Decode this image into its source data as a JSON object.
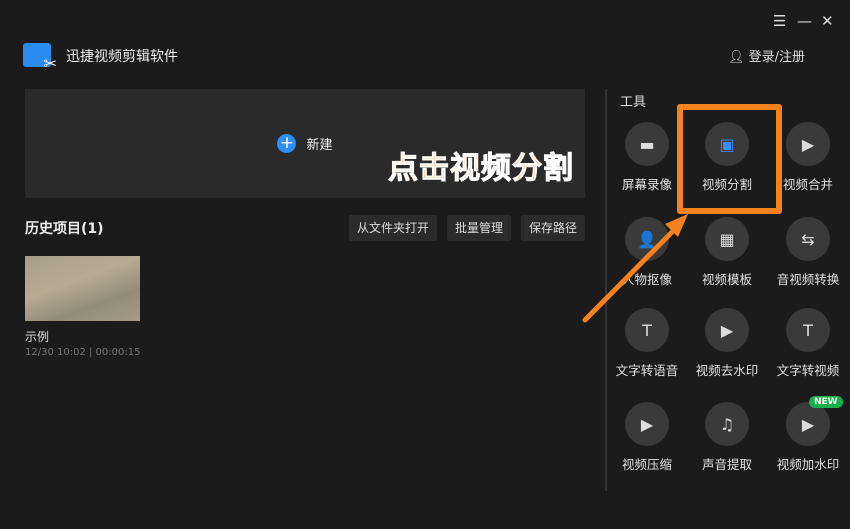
{
  "window": {
    "menu_icon": "☰",
    "minimize_icon": "—",
    "close_icon": "✕"
  },
  "header": {
    "app_title": "迅捷视频剪辑软件",
    "login_label": "登录/注册"
  },
  "new_project": {
    "label": "新建"
  },
  "history": {
    "title": "历史项目(1)",
    "buttons": [
      "从文件夹打开",
      "批量管理",
      "保存路径"
    ],
    "items": [
      {
        "name": "示例",
        "meta": "12/30 10:02 | 00:00:15"
      }
    ]
  },
  "tools": {
    "title": "工具",
    "items": [
      {
        "label": "屏幕录像",
        "icon": "camera-icon",
        "glyph": "▬"
      },
      {
        "label": "视频分割",
        "icon": "film-split-icon",
        "glyph": "▣"
      },
      {
        "label": "视频合并",
        "icon": "video-merge-icon",
        "glyph": "▶"
      },
      {
        "label": "人物抠像",
        "icon": "person-cutout-icon",
        "glyph": "👤"
      },
      {
        "label": "视频模板",
        "icon": "template-icon",
        "glyph": "▦"
      },
      {
        "label": "音视频转换",
        "icon": "convert-icon",
        "glyph": "⇆"
      },
      {
        "label": "文字转语音",
        "icon": "text-to-speech-icon",
        "glyph": "T"
      },
      {
        "label": "视频去水印",
        "icon": "remove-watermark-icon",
        "glyph": "▶"
      },
      {
        "label": "文字转视频",
        "icon": "text-to-video-icon",
        "glyph": "T"
      },
      {
        "label": "视频压缩",
        "icon": "compress-icon",
        "glyph": "▶"
      },
      {
        "label": "声音提取",
        "icon": "music-extract-icon",
        "glyph": "♫"
      },
      {
        "label": "视频加水印",
        "icon": "add-watermark-icon",
        "glyph": "▶"
      }
    ],
    "new_badge": "NEW"
  },
  "annotation": {
    "text": "点击视频分割",
    "color": "#f5821f"
  }
}
